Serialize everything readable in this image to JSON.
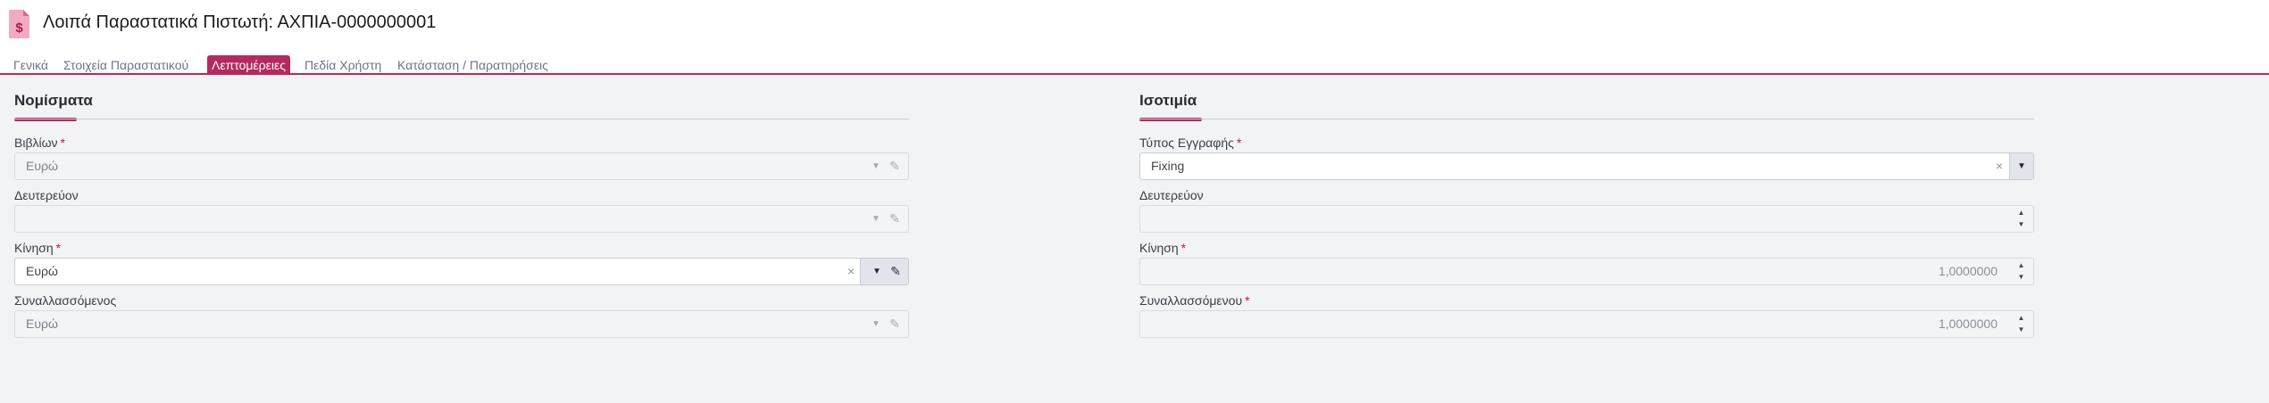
{
  "header": {
    "title": "Λοιπά Παραστατικά Πιστωτή: ΑΧΠΙΑ-0000000001",
    "icon": "document-dollar-icon",
    "accent_color": "#b5295f"
  },
  "tabs": [
    {
      "label": "Γενικά",
      "active": false
    },
    {
      "label": "Στοιχεία Παραστατικού",
      "active": false
    },
    {
      "label": "Λεπτομέρειες",
      "active": true
    },
    {
      "label": "Πεδία Χρήστη",
      "active": false
    },
    {
      "label": "Κατάσταση / Παρατηρήσεις",
      "active": false
    }
  ],
  "currencies": {
    "title": "Νομίσματα",
    "fields": [
      {
        "label": "Βιβλίων",
        "required": "*",
        "value": "Ευρώ",
        "enabled": false
      },
      {
        "label": "Δευτερεύον",
        "required": "",
        "value": "",
        "enabled": false
      },
      {
        "label": "Κίνηση",
        "required": "*",
        "value": "Ευρώ",
        "enabled": true,
        "clear": "×"
      },
      {
        "label": "Συναλλασσόμενος",
        "required": "",
        "value": "Ευρώ",
        "enabled": false
      }
    ]
  },
  "parity": {
    "title": "Ισοτιμία",
    "fields": [
      {
        "label": "Τύπος Εγγραφής",
        "required": "*",
        "value": "Fixing",
        "clear": "×"
      },
      {
        "label": "Δευτερεύον",
        "required": "",
        "value": ""
      },
      {
        "label": "Κίνηση",
        "required": "*",
        "value": "1,0000000"
      },
      {
        "label": "Συναλλασσόμενου",
        "required": "*",
        "value": "1,0000000"
      }
    ]
  },
  "icons": {
    "dropdown": "▼",
    "edit": "✎",
    "spin_up": "▲",
    "spin_down": "▼"
  }
}
